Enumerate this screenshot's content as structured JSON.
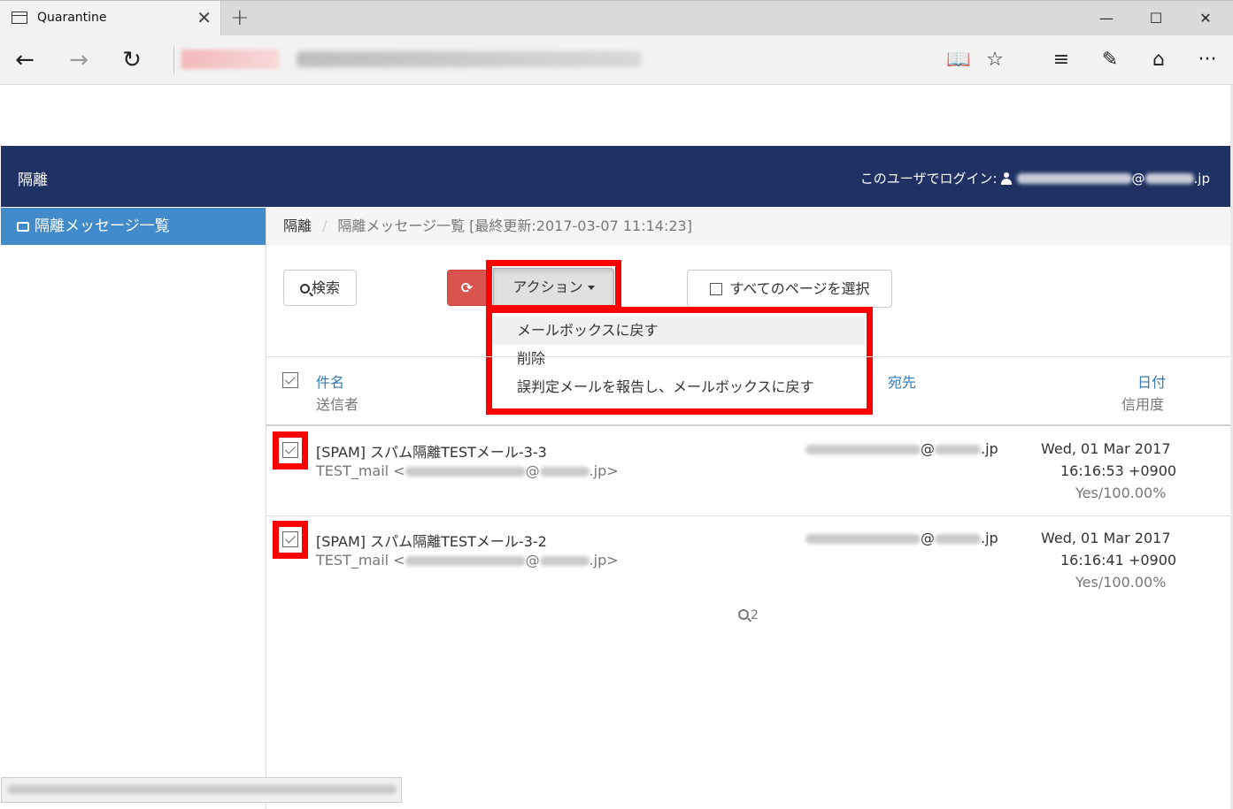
{
  "browser": {
    "tab_title": "Quarantine",
    "tab_close": "✕",
    "new_tab": "+",
    "window_buttons": {
      "minimize": "—",
      "maximize": "☐",
      "close": "✕"
    },
    "nav": {
      "back": "←",
      "forward": "→",
      "refresh": "↻"
    },
    "tools": {
      "reading_view": "📖",
      "favorite": "☆",
      "hub": "≡",
      "web_note": "✎",
      "share": "⌂",
      "more": "···"
    }
  },
  "app": {
    "title": "隔離",
    "login_label": "このユーザでログイン:",
    "login_at": "@",
    "login_domain": ".jp"
  },
  "sidebar": {
    "items": [
      {
        "label": "隔離メッセージ一覧",
        "active": true,
        "icon": "inbox-icon"
      }
    ]
  },
  "breadcrumb": {
    "root": "隔離",
    "separator": "/",
    "current": "隔離メッセージ一覧 [最終更新:2017-03-07 11:14:23]"
  },
  "toolbar": {
    "search_label": "検索",
    "refresh_icon": "⟳",
    "action_label": "アクション",
    "select_all_label": "すべてのページを選択"
  },
  "action_menu": {
    "items": [
      {
        "label": "メールボックスに戻す",
        "hover": true
      },
      {
        "label": "削除"
      },
      {
        "label": "誤判定メールを報告し、メールボックスに戻す"
      }
    ]
  },
  "table": {
    "headers": {
      "subject": "件名",
      "sender": "送信者",
      "recipient": "宛先",
      "date": "日付",
      "confidence": "信用度"
    },
    "rows": [
      {
        "subject": "[SPAM] スパム隔離TESTメール-3-3",
        "sender_name": "TEST_mail <",
        "sender_at": "@",
        "sender_end": ".jp>",
        "recipient_at": "@",
        "recipient_end": ".jp",
        "date": "Wed, 01 Mar 2017",
        "time": "16:16:53 +0900",
        "confidence": "Yes/100.00%",
        "checked": true
      },
      {
        "subject": "[SPAM] スパム隔離TESTメール-3-2",
        "sender_name": "TEST_mail <",
        "sender_at": "@",
        "sender_end": ".jp>",
        "recipient_at": "@",
        "recipient_end": ".jp",
        "date": "Wed, 01 Mar 2017",
        "time": "16:16:41 +0900",
        "confidence": "Yes/100.00%",
        "checked": true
      }
    ]
  },
  "pager": {
    "count": "2"
  },
  "colors": {
    "header_bg": "#1f3263",
    "sidebar_active": "#428bca",
    "highlight": "#ff0000",
    "refresh_btn": "#d9534f",
    "link": "#337ab7"
  }
}
